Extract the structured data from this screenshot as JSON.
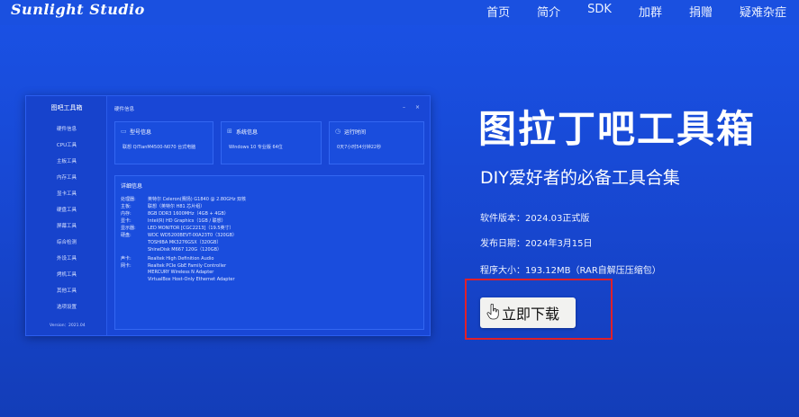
{
  "header": {
    "logo": "Sunlight Studio",
    "nav": [
      "首页",
      "简介",
      "SDK",
      "加群",
      "捐赠",
      "疑难杂症"
    ]
  },
  "app_screenshot": {
    "sidebar_title": "图吧工具箱",
    "sidebar_items": [
      "硬件信息",
      "CPU工具",
      "主板工具",
      "内存工具",
      "显卡工具",
      "硬盘工具",
      "屏幕工具",
      "综合检测",
      "外设工具",
      "烤机工具",
      "其他工具",
      "选项设置"
    ],
    "version": "Version：2021.04",
    "main_title": "硬件信息",
    "window_buttons": [
      "–",
      "×"
    ],
    "cards": [
      {
        "icon": "monitor-icon",
        "title": "型号信息",
        "value": "联想 QiTianM4500-N070 台式电脑"
      },
      {
        "icon": "windows-icon",
        "title": "系统信息",
        "value": "Windows 10 专业版 64位"
      },
      {
        "icon": "clock-icon",
        "title": "运行时间",
        "value": "0天7小时54分钟22秒"
      }
    ],
    "detail_title": "详细信息",
    "details": [
      {
        "label": "处理器:",
        "value": "英特尔 Celeron(赛扬) G1840 @ 2.80GHz 双核"
      },
      {
        "label": "主板:",
        "value": "联想（英特尔 H81 芯片组）"
      },
      {
        "label": "内存:",
        "value": "8GB DDR3 1600MHz（4GB + 4GB）"
      },
      {
        "label": "显卡:",
        "value": "Intel(R) HD Graphics（1GB / 联想）"
      },
      {
        "label": "显示器:",
        "value": "LED MONITOR [CGC2213]（19.5英寸）"
      },
      {
        "label": "硬盘:",
        "value": "WDC WD5200BEVT-00A23T0（320GB）"
      },
      {
        "label": "",
        "value": "TOSHIBA MK3276GSX（320GB）"
      },
      {
        "label": "",
        "value": "ShineDisk M667 120G（120GB）"
      },
      {
        "label": "声卡:",
        "value": "Realtek High Definition Audio"
      },
      {
        "label": "网卡:",
        "value": "Realtek PCIe GbE Family Controller"
      },
      {
        "label": "",
        "value": "MERCURY Wireless N Adapter"
      },
      {
        "label": "",
        "value": "VirtualBox Host-Only Ethernet Adapter"
      }
    ]
  },
  "product": {
    "title": "图拉丁吧工具箱",
    "subtitle": "DIY爱好者的必备工具合集",
    "version": "软件版本：2024.03正式版",
    "release_date": "发布日期：2024年3月15日",
    "size": "程序大小：193.12MB（RAR自解压压缩包）",
    "download_label": "立即下载"
  },
  "colors": {
    "background": "#1a50e0",
    "highlight_border": "#e0202a",
    "button": "#f2f2f0"
  }
}
